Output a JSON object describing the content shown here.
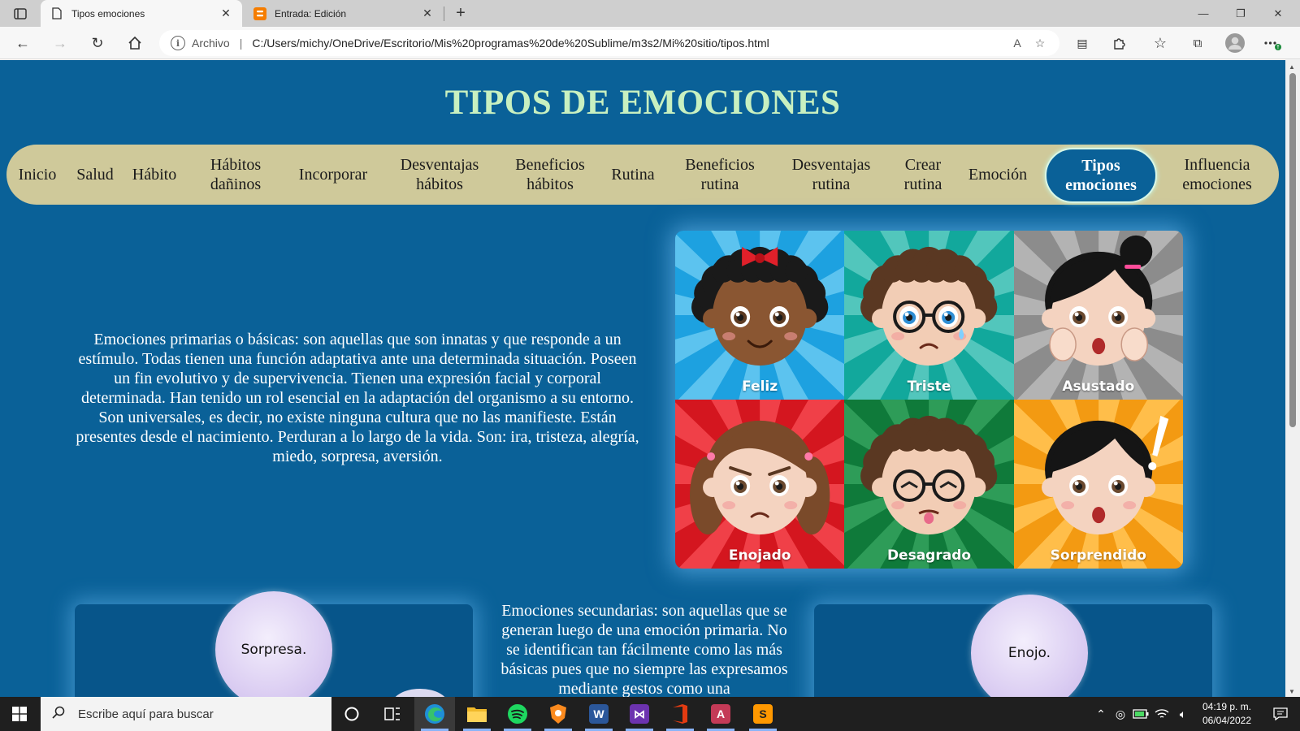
{
  "browser": {
    "tabs": [
      {
        "title": "Tipos emociones",
        "active": true
      },
      {
        "title": "Entrada: Edición",
        "active": false
      }
    ],
    "address": {
      "scheme_label": "Archivo",
      "url": "C:/Users/michy/OneDrive/Escritorio/Mis%20programas%20de%20Sublime/m3s2/Mi%20sitio/tipos.html"
    },
    "colors": {
      "tabstrip": "#cfcfcf",
      "toolbar": "#f7f7f7",
      "blogger_orange": "#f57d00"
    }
  },
  "page": {
    "title": "TIPOS DE EMOCIONES",
    "nav": [
      {
        "label_lines": [
          "Inicio"
        ],
        "active": false
      },
      {
        "label_lines": [
          "Salud"
        ],
        "active": false
      },
      {
        "label_lines": [
          "Hábito"
        ],
        "active": false
      },
      {
        "label_lines": [
          "Hábitos",
          "dañinos"
        ],
        "active": false
      },
      {
        "label_lines": [
          "Incorporar"
        ],
        "active": false
      },
      {
        "label_lines": [
          "Desventajas",
          "hábitos"
        ],
        "active": false
      },
      {
        "label_lines": [
          "Beneficios",
          "hábitos"
        ],
        "active": false
      },
      {
        "label_lines": [
          "Rutina"
        ],
        "active": false
      },
      {
        "label_lines": [
          "Beneficios",
          "rutina"
        ],
        "active": false
      },
      {
        "label_lines": [
          "Desventajas",
          "rutina"
        ],
        "active": false
      },
      {
        "label_lines": [
          "Crear",
          "rutina"
        ],
        "active": false
      },
      {
        "label_lines": [
          "Emoción"
        ],
        "active": false
      },
      {
        "label_lines": [
          "Tipos",
          "emociones"
        ],
        "active": true
      },
      {
        "label_lines": [
          "Influencia",
          "emociones"
        ],
        "active": false
      }
    ],
    "primary_text": "Emociones primarias o básicas: son aquellas que son innatas y que responde a un estímulo. Todas tienen una función adaptativa ante una determinada situación. Poseen un fin evolutivo y de supervivencia. Tienen una expresión facial y corporal determinada. Han tenido un rol esencial en la adaptación del organismo a su entorno. Son universales, es decir, no existe ninguna cultura que no las manifieste. Están presentes desde el nacimiento. Perduran a lo largo de la vida. Son: ira, tristeza, alegría, miedo, sorpresa, aversión.",
    "emotions": [
      {
        "label": "Feliz",
        "bg": "#1da1e0",
        "ray": "#5cc3ef",
        "skin": "#8a5632",
        "hair": "#1a1a1a",
        "accessory": "bow",
        "mood": "happy"
      },
      {
        "label": "Triste",
        "bg": "#12a89c",
        "ray": "#52c6bc",
        "skin": "#f2cdb5",
        "hair": "#5a3822",
        "accessory": "glasses",
        "mood": "sad"
      },
      {
        "label": "Asustado",
        "bg": "#8c8c8c",
        "ray": "#b3b3b3",
        "skin": "#f4d3c0",
        "hair": "#151515",
        "accessory": "bun",
        "mood": "scared"
      },
      {
        "label": "Enojado",
        "bg": "#d4161f",
        "ray": "#f04048",
        "skin": "#f4d3c0",
        "hair": "#7a4a2a",
        "accessory": "pigtails",
        "mood": "angry"
      },
      {
        "label": "Desagrado",
        "bg": "#0f7a3a",
        "ray": "#2e9c58",
        "skin": "#f2cdb5",
        "hair": "#5a3822",
        "accessory": "glasses",
        "mood": "disgust"
      },
      {
        "label": "Sorprendido",
        "bg": "#f39a12",
        "ray": "#ffbe4a",
        "skin": "#f4d3c0",
        "hair": "#151515",
        "accessory": "exclaim",
        "mood": "surprised"
      }
    ],
    "secondary_text": "Emociones secundarias: son aquellas que se generan luego de una emoción primaria. No se identifican tan fácilmente como las más básicas pues que no siempre las expresamos mediante gestos como una",
    "cards": [
      {
        "bubble_label": "Sorpresa."
      },
      {
        "bubble_label": "Enojo."
      }
    ],
    "colors": {
      "background": "#0a6198",
      "title": "#c8f0c0",
      "nav_bg": "#cfc99a",
      "active_nav_text": "#ffffff"
    }
  },
  "taskbar": {
    "search_placeholder": "Escribe aquí para buscar",
    "clock_time": "04:19 p. m.",
    "clock_date": "06/04/2022"
  }
}
